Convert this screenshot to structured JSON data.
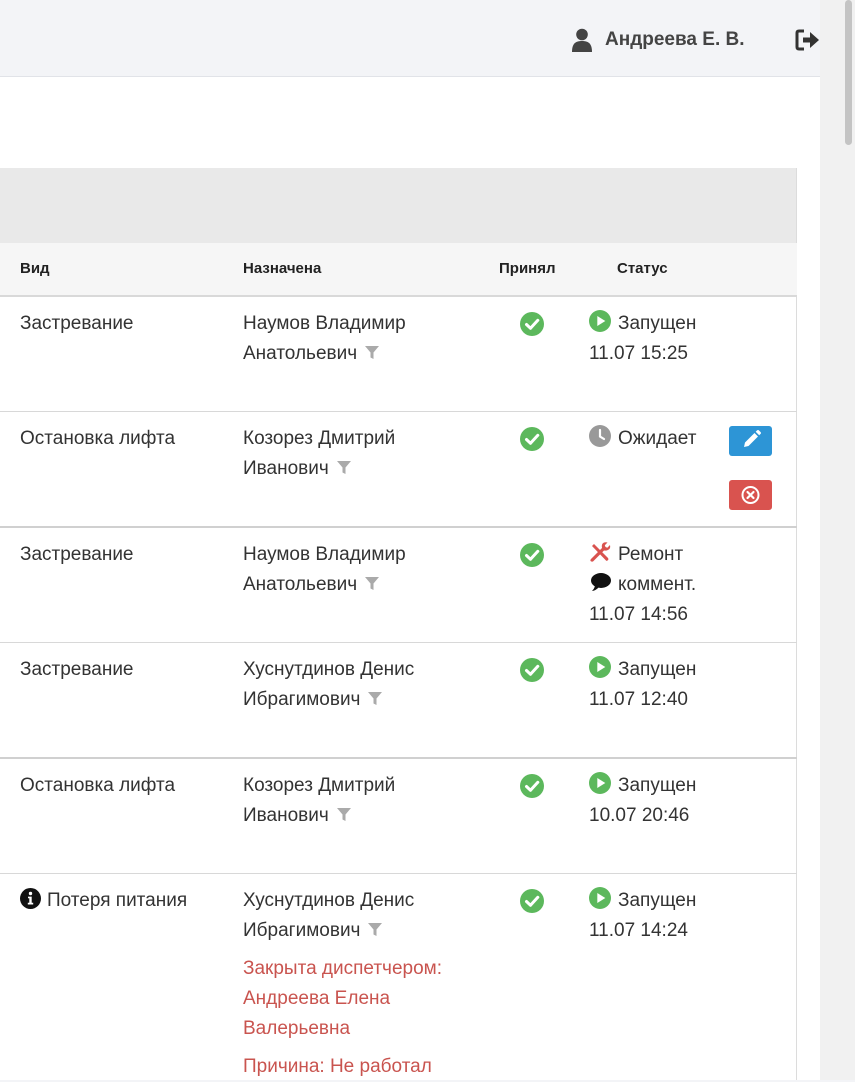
{
  "header": {
    "user_name": "Андреева Е. В."
  },
  "table": {
    "columns": {
      "kind": "Вид",
      "assigned": "Назначена",
      "accepted": "Принял",
      "status": "Статус"
    },
    "rows": [
      {
        "kind": "Застревание",
        "assigned_1": "Наумов Владимир",
        "assigned_2": "Анатольевич",
        "status_icon": "play-icon",
        "status": "Запущен",
        "time": "11.07 15:25"
      },
      {
        "kind": "Остановка лифта",
        "assigned_1": "Козорез Дмитрий",
        "assigned_2": "Иванович",
        "status_icon": "clock-icon",
        "status": "Ожидает",
        "actions": [
          "edit-button",
          "cancel-button"
        ]
      },
      {
        "kind": "Застревание",
        "assigned_1": "Наумов Владимир",
        "assigned_2": "Анатольевич",
        "status_icon": "wrench-icon",
        "status": "Ремонт",
        "comment": "коммент.",
        "time": "11.07 14:56"
      },
      {
        "kind": "Застревание",
        "assigned_1": "Хуснутдинов Денис",
        "assigned_2": "Ибрагимович",
        "status_icon": "play-icon",
        "status": "Запущен",
        "time": "11.07 12:40"
      },
      {
        "kind": "Остановка лифта",
        "assigned_1": "Козорез Дмитрий",
        "assigned_2": "Иванович",
        "status_icon": "play-icon",
        "status": "Запущен",
        "time": "10.07 20:46"
      },
      {
        "kind": "Потеря питания",
        "kind_icon": "info-icon",
        "assigned_1": "Хуснутдинов Денис",
        "assigned_2": "Ибрагимович",
        "closed_1": "Закрыта диспетчером:",
        "closed_2": "Андреева Елена",
        "closed_3": "Валерьевна",
        "reason": "Причина: Не работал",
        "status_icon": "play-icon",
        "status": "Запущен",
        "time": "11.07 14:24"
      }
    ]
  },
  "colors": {
    "green": "#5cb85c",
    "blue": "#2d95d6",
    "red": "#d9534f",
    "closed_text": "#c9544f",
    "gray_icon": "#999999"
  }
}
